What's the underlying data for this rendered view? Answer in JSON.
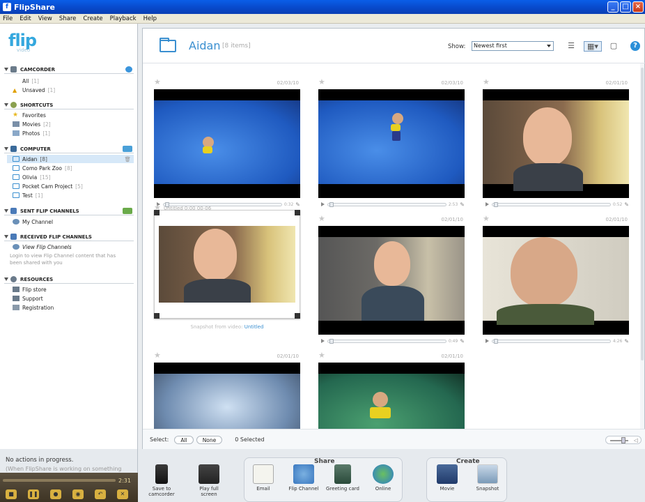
{
  "window": {
    "title": "FlipShare"
  },
  "menu": [
    "File",
    "Edit",
    "View",
    "Share",
    "Create",
    "Playback",
    "Help"
  ],
  "logo": {
    "text": "flip",
    "sub": "video"
  },
  "sidebar": {
    "camcorder": {
      "label": "CAMCORDER",
      "items": [
        {
          "label": "All",
          "count": "[1]"
        },
        {
          "label": "Unsaved",
          "count": "[1]"
        }
      ]
    },
    "shortcuts": {
      "label": "SHORTCUTS",
      "items": [
        {
          "label": "Favorites",
          "count": ""
        },
        {
          "label": "Movies",
          "count": "[2]"
        },
        {
          "label": "Photos",
          "count": "[1]"
        }
      ]
    },
    "computer": {
      "label": "COMPUTER",
      "items": [
        {
          "label": "Aidan",
          "count": "[8]"
        },
        {
          "label": "Como Park Zoo",
          "count": "[8]"
        },
        {
          "label": "Olivia",
          "count": "[15]"
        },
        {
          "label": "Pocket Cam Project",
          "count": "[5]"
        },
        {
          "label": "Test",
          "count": "[1]"
        }
      ]
    },
    "sent": {
      "label": "SENT FLIP CHANNELS",
      "items": [
        {
          "label": "My Channel",
          "count": ""
        }
      ]
    },
    "received": {
      "label": "RECEIVED FLIP CHANNELS",
      "items": [
        {
          "label": "View Flip Channels",
          "count": ""
        }
      ],
      "note": "Login to view Flip Channel content that has been shared with you"
    },
    "resources": {
      "label": "RESOURCES",
      "items": [
        {
          "label": "Flip store"
        },
        {
          "label": "Support"
        },
        {
          "label": "Registration"
        }
      ]
    }
  },
  "main": {
    "folder_title": "Aidan",
    "folder_count": "[8 items]",
    "show_label": "Show:",
    "show_value": "Newest first",
    "tiles": [
      {
        "date": "02/03/10",
        "duration": "0:32"
      },
      {
        "date": "02/03/10",
        "duration": "2:53"
      },
      {
        "date": "02/01/10",
        "duration": "0:52"
      },
      {
        "title": "Untitled 0:00 00-06",
        "caption_prefix": "Snapshot from video:",
        "caption_link": "Untitled"
      },
      {
        "date": "02/01/10",
        "duration": "0:49"
      },
      {
        "date": "02/01/10",
        "duration": "4:26"
      },
      {
        "date": "02/01/10"
      },
      {
        "date": "02/01/10"
      }
    ],
    "footer": {
      "select_label": "Select:",
      "all": "All",
      "none": "None",
      "selected": "0 Selected"
    }
  },
  "status": {
    "line1": "No actions in progress.",
    "line2": "(When FlipShare is working on something"
  },
  "player": {
    "time": "2:31"
  },
  "actions": {
    "save": "Save to camcorder",
    "play_full": "Play full screen",
    "share_label": "Share",
    "email": "Email",
    "flip_channel": "Flip Channel",
    "greeting": "Greeting card",
    "online": "Online",
    "create_label": "Create",
    "movie": "Movie",
    "snapshot": "Snapshot"
  }
}
